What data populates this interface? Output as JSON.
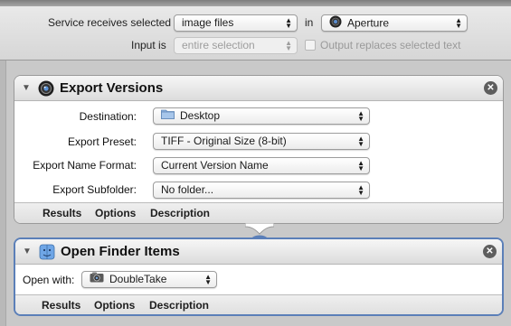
{
  "service_bar": {
    "receives_label": "Service receives selected",
    "type_value": "image files",
    "in_label": "in",
    "app_value": "Aperture",
    "input_is_label": "Input is",
    "input_value": "entire selection",
    "output_replaces_label": "Output replaces selected text"
  },
  "actions": [
    {
      "title": "Export Versions",
      "icon": "aperture-icon",
      "fields": [
        {
          "label": "Destination:",
          "value": "Desktop",
          "icon": "folder-icon"
        },
        {
          "label": "Export Preset:",
          "value": "TIFF - Original Size (8-bit)"
        },
        {
          "label": "Export Name Format:",
          "value": "Current Version Name"
        },
        {
          "label": "Export Subfolder:",
          "value": "No folder..."
        }
      ],
      "tabs": [
        "Results",
        "Options",
        "Description"
      ]
    },
    {
      "title": "Open Finder Items",
      "icon": "finder-icon",
      "fields": [
        {
          "label": "Open with:",
          "value": "DoubleTake",
          "icon": "doubletake-icon"
        }
      ],
      "tabs": [
        "Results",
        "Options",
        "Description"
      ]
    }
  ],
  "colors": {
    "selected_border": "#5b7fb8",
    "background": "#c9c9c9"
  }
}
